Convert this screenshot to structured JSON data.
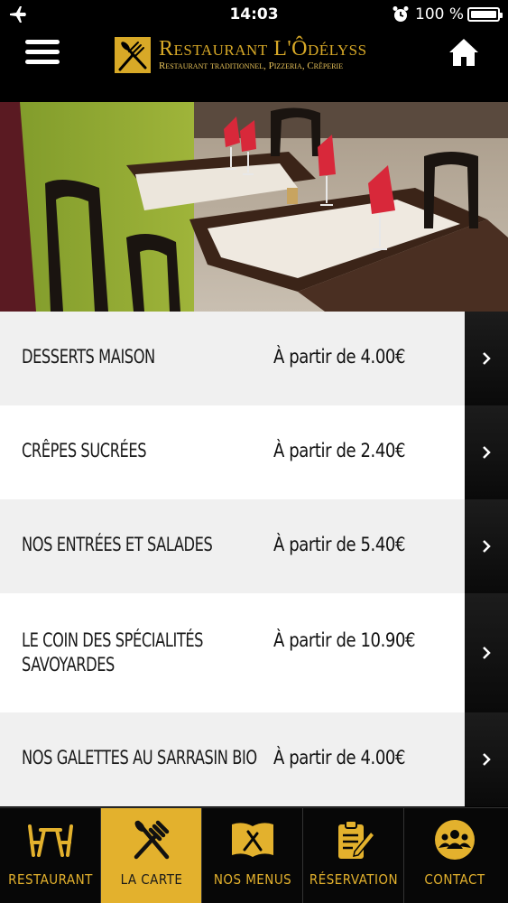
{
  "status_bar": {
    "time": "14:03",
    "battery": "100 %"
  },
  "header": {
    "brand_name": "Restaurant L'Ôdélyss",
    "brand_subtitle": "Restaurant traditionnel, Pizzeria, Crêperie"
  },
  "menu_items": [
    {
      "title": "DESSERTS MAISON",
      "price": "À partir de 4.00€"
    },
    {
      "title": "CRÊPES SUCRÉES",
      "price": "À partir de 2.40€"
    },
    {
      "title": "NOS ENTRÉES ET SALADES",
      "price": "À partir de 5.40€"
    },
    {
      "title": "LE COIN DES SPÉCIALITÉS SAVOYARDES",
      "price": "À partir de 10.90€"
    },
    {
      "title": "NOS GALETTES AU SARRASIN BIO",
      "price": "À partir de 4.00€"
    }
  ],
  "tabs": [
    {
      "label": "RESTAURANT",
      "icon": "table-chairs-icon"
    },
    {
      "label": "LA CARTE",
      "icon": "fork-knife-icon"
    },
    {
      "label": "NOS MENUS",
      "icon": "menu-book-icon"
    },
    {
      "label": "RÉSERVATION",
      "icon": "clipboard-pen-icon"
    },
    {
      "label": "CONTACT",
      "icon": "group-icon"
    }
  ],
  "active_tab": "LA CARTE",
  "colors": {
    "accent": "#e3b12d",
    "background": "#000000",
    "row_light": "#f0f0f0",
    "row_white": "#ffffff"
  }
}
